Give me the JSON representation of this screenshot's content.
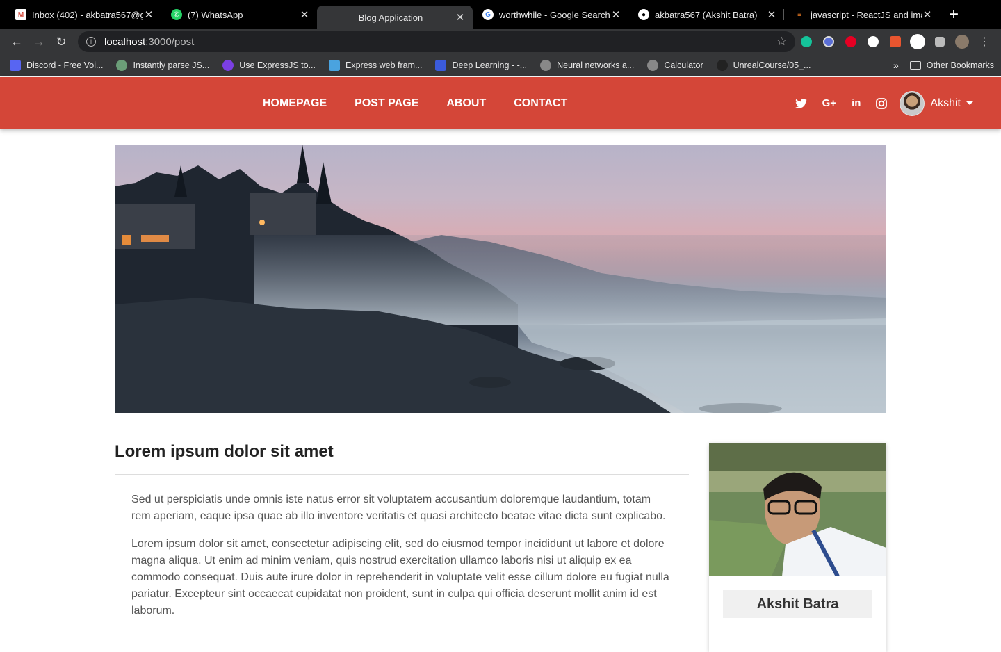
{
  "browser": {
    "tabs": [
      {
        "title": "Inbox (402) - akbatra567@g",
        "icon": "gmail-icon",
        "color": "#d44638",
        "active": false
      },
      {
        "title": "(7) WhatsApp",
        "icon": "whatsapp-icon",
        "color": "#25d366",
        "active": false
      },
      {
        "title": "Blog Application",
        "icon": "",
        "color": "",
        "active": true
      },
      {
        "title": "worthwhile - Google Search",
        "icon": "google-icon",
        "color": "#4285f4",
        "active": false
      },
      {
        "title": "akbatra567 (Akshit Batra)",
        "icon": "github-icon",
        "color": "#ffffff",
        "active": false
      },
      {
        "title": "javascript - ReactJS and ima",
        "icon": "stackoverflow-icon",
        "color": "#f48024",
        "active": false
      }
    ],
    "url_host": "localhost",
    "url_path": ":3000/post",
    "bookmarks": [
      {
        "label": "Discord - Free Voi...",
        "color": "#5865f2"
      },
      {
        "label": "Instantly parse JS...",
        "color": "#6b9e78"
      },
      {
        "label": "Use ExpressJS to...",
        "color": "#7b3fe4"
      },
      {
        "label": "Express web fram...",
        "color": "#4aa3df"
      },
      {
        "label": "Deep Learning - -...",
        "color": "#3b5bdb"
      },
      {
        "label": "Neural networks a...",
        "color": "#888888"
      },
      {
        "label": "Calculator",
        "color": "#888888"
      },
      {
        "label": "UnrealCourse/05_...",
        "color": "#222222"
      }
    ],
    "other_bookmarks": "Other Bookmarks"
  },
  "nav": {
    "menu": [
      "HOMEPAGE",
      "POST PAGE",
      "ABOUT",
      "CONTACT"
    ],
    "user_name": "Akshit",
    "brand_color": "#d44638"
  },
  "post": {
    "title": "Lorem ipsum dolor sit amet",
    "paragraphs": [
      "Sed ut perspiciatis unde omnis iste natus error sit voluptatem accusantium doloremque laudantium, totam rem aperiam, eaque ipsa quae ab illo inventore veritatis et quasi architecto beatae vitae dicta sunt explicabo.",
      "Lorem ipsum dolor sit amet, consectetur adipiscing elit, sed do eiusmod tempor incididunt ut labore et dolore magna aliqua. Ut enim ad minim veniam, quis nostrud exercitation ullamco laboris nisi ut aliquip ex ea commodo consequat. Duis aute irure dolor in reprehenderit in voluptate velit esse cillum dolore eu fugiat nulla pariatur. Excepteur sint occaecat cupidatat non proident, sunt in culpa qui officia deserunt mollit anim id est laborum."
    ]
  },
  "author": {
    "name": "Akshit Batra"
  }
}
